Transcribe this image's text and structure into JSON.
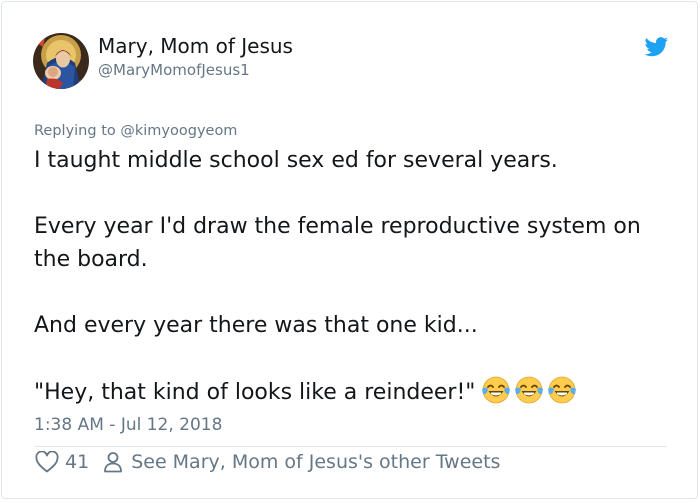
{
  "author": {
    "display_name": "Mary, Mom of Jesus",
    "handle": "@MaryMomofJesus1"
  },
  "icons": {
    "brand": "twitter-bird-icon",
    "like": "heart-icon",
    "profile": "person-icon",
    "emoji": "face-with-tears-of-joy"
  },
  "colors": {
    "twitter_blue": "#1da1f2",
    "secondary_text": "#657786",
    "primary_text": "#14171a",
    "border": "#e1e8ed"
  },
  "tweet": {
    "replying_prefix": "Replying to",
    "replying_to": "@kimyoogyeom",
    "line1": "I taught middle school sex ed for several years.",
    "line2": "Every year I'd draw the female reproductive system on the board.",
    "line3": "And every year there was that one kid...",
    "line4": "\"Hey, that kind of looks like a reindeer!\"",
    "emoji_count": 3,
    "timestamp": "1:38 AM - Jul 12, 2018"
  },
  "actions": {
    "like_count": "41",
    "other_tweets_link": "See Mary, Mom of Jesus's other Tweets"
  }
}
